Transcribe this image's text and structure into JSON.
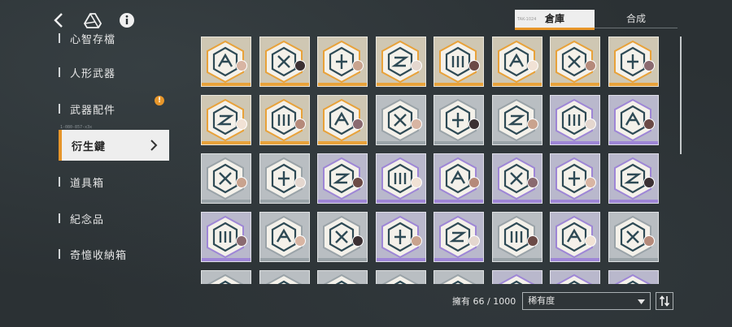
{
  "header": {
    "icons": [
      "back-icon",
      "drive-icon",
      "info-icon"
    ]
  },
  "sidebar": {
    "items": [
      {
        "label": "心智存檔",
        "state": "clipped"
      },
      {
        "label": "人形武器",
        "state": "normal"
      },
      {
        "label": "武器配件",
        "state": "normal",
        "badge": "!"
      },
      {
        "label": "衍生鍵",
        "state": "active"
      },
      {
        "label": "道具箱",
        "state": "normal"
      },
      {
        "label": "紀念品",
        "state": "normal"
      },
      {
        "label": "奇憶收納箱",
        "state": "normal"
      }
    ],
    "note": "1-080-857-x3x"
  },
  "tabs": {
    "warehouse": "倉庫",
    "synthesis": "合成",
    "tiny_label": "TAK-1024"
  },
  "grid": {
    "rarity_colors": {
      "gold": "#e8a23a",
      "purple": "#9e86d6",
      "gray": "#9aa3a8"
    },
    "rows": [
      [
        "gold",
        "gold",
        "gold",
        "gold",
        "gold",
        "gold",
        "gold",
        "gold"
      ],
      [
        "gold",
        "gold",
        "gold",
        "gray",
        "gray",
        "gray",
        "purple",
        "purple"
      ],
      [
        "gray",
        "gray",
        "purple",
        "purple",
        "purple",
        "purple",
        "purple",
        "purple"
      ],
      [
        "purple",
        "gray",
        "gray",
        "purple",
        "purple",
        "gray",
        "purple",
        "gray"
      ],
      [
        "gray",
        "gray",
        "gray",
        "gray",
        "gray",
        "purple",
        "purple",
        "purple"
      ]
    ]
  },
  "footer": {
    "owned": "擁有 66 / 1000",
    "sort_value": "稀有度"
  }
}
